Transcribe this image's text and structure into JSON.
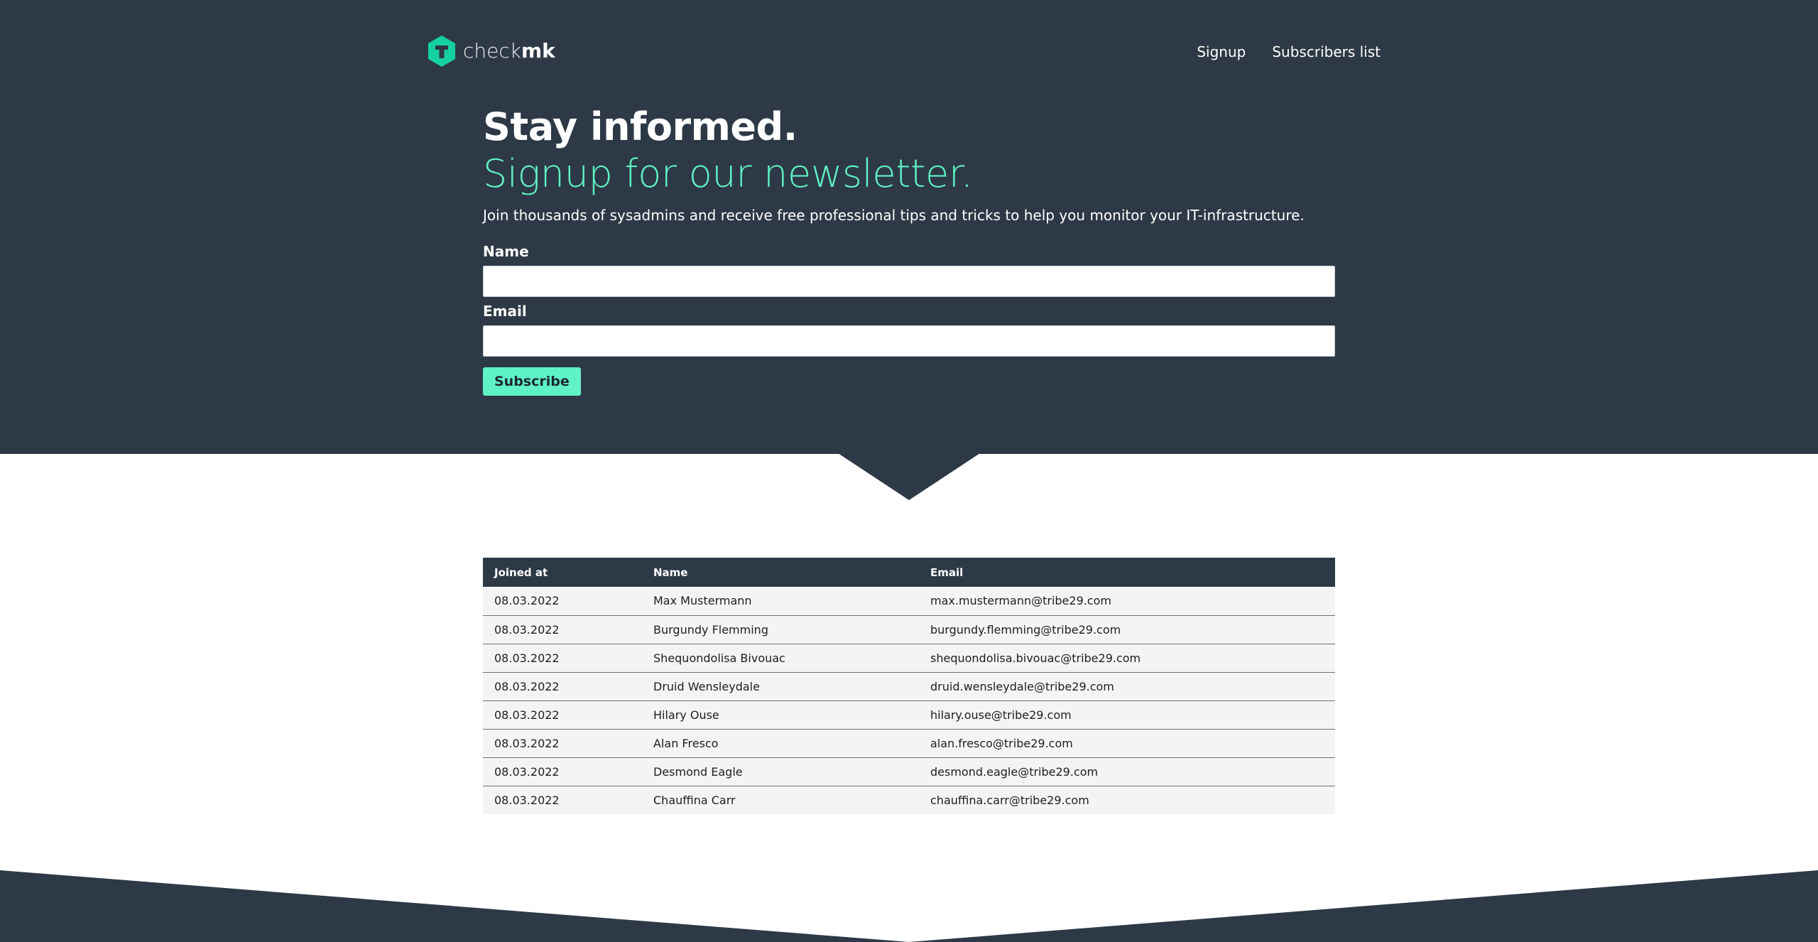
{
  "header": {
    "logo": {
      "text_light": "check",
      "text_bold": "mk"
    },
    "nav": [
      {
        "label": "Signup"
      },
      {
        "label": "Subscribers list"
      }
    ]
  },
  "hero": {
    "title": "Stay informed.",
    "subtitle": "Signup for our newsletter.",
    "lead": "Join thousands of sysadmins and receive free professional tips and tricks to help you monitor your IT-infrastructure.",
    "form": {
      "name_label": "Name",
      "name_value": "",
      "email_label": "Email",
      "email_value": "",
      "submit_label": "Subscribe"
    }
  },
  "subscribers": {
    "columns": [
      "Joined at",
      "Name",
      "Email"
    ],
    "rows": [
      {
        "joined": "08.03.2022",
        "name": "Max Mustermann",
        "email": "max.mustermann@tribe29.com"
      },
      {
        "joined": "08.03.2022",
        "name": "Burgundy Flemming",
        "email": "burgundy.flemming@tribe29.com"
      },
      {
        "joined": "08.03.2022",
        "name": "Shequondolisa Bivouac",
        "email": "shequondolisa.bivouac@tribe29.com"
      },
      {
        "joined": "08.03.2022",
        "name": "Druid Wensleydale",
        "email": "druid.wensleydale@tribe29.com"
      },
      {
        "joined": "08.03.2022",
        "name": "Hilary Ouse",
        "email": "hilary.ouse@tribe29.com"
      },
      {
        "joined": "08.03.2022",
        "name": "Alan Fresco",
        "email": "alan.fresco@tribe29.com"
      },
      {
        "joined": "08.03.2022",
        "name": "Desmond Eagle",
        "email": "desmond.eagle@tribe29.com"
      },
      {
        "joined": "08.03.2022",
        "name": "Chauffina Carr",
        "email": "chauffina.carr@tribe29.com"
      }
    ]
  },
  "colors": {
    "dark_background": "#2d3946",
    "accent": "#5ff2c4",
    "logo_green": "#15d1a0",
    "row_background": "#f4f4f4"
  },
  "icons": {
    "logo": "checkmk-hexagon-logo-icon"
  }
}
